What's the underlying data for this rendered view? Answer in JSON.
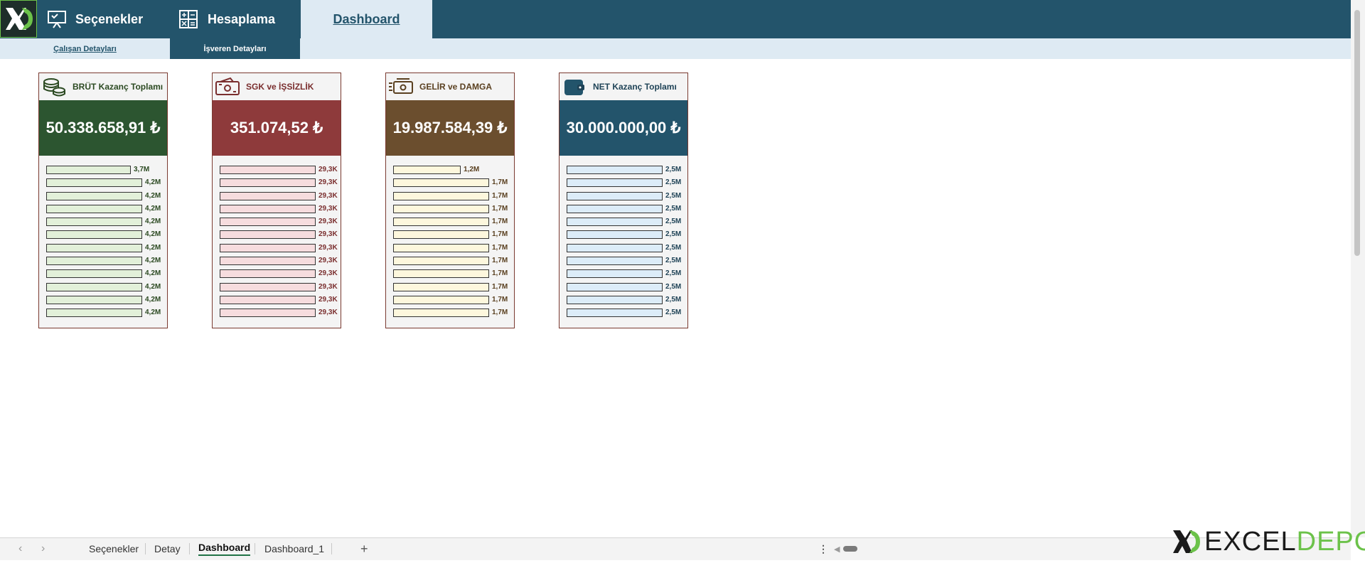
{
  "nav": {
    "options": "Seçenekler",
    "calc": "Hesaplama",
    "dashboard": "Dashboard"
  },
  "subnav": {
    "employee": "Çalışan Detayları",
    "employer": "İşveren Detayları"
  },
  "cards": [
    {
      "title": "BRÜT Kazanç Toplamı",
      "value": "50.338.658,91 ₺",
      "accent": "#2c5530",
      "bar_fill": "#e2f0d9",
      "label_color": "#2c4a22",
      "bars": [
        {
          "label": "3,7M",
          "value": 3.7
        },
        {
          "label": "4,2M",
          "value": 4.2
        },
        {
          "label": "4,2M",
          "value": 4.2
        },
        {
          "label": "4,2M",
          "value": 4.2
        },
        {
          "label": "4,2M",
          "value": 4.2
        },
        {
          "label": "4,2M",
          "value": 4.2
        },
        {
          "label": "4,2M",
          "value": 4.2
        },
        {
          "label": "4,2M",
          "value": 4.2
        },
        {
          "label": "4,2M",
          "value": 4.2
        },
        {
          "label": "4,2M",
          "value": 4.2
        },
        {
          "label": "4,2M",
          "value": 4.2
        },
        {
          "label": "4,2M",
          "value": 4.2
        }
      ]
    },
    {
      "title": "SGK ve İŞSİZLİK",
      "value": "351.074,52 ₺",
      "accent": "#8e3a3b",
      "bar_fill": "#f6dcde",
      "label_color": "#7a2e2e",
      "bars": [
        {
          "label": "29,3K",
          "value": 29.3
        },
        {
          "label": "29,3K",
          "value": 29.3
        },
        {
          "label": "29,3K",
          "value": 29.3
        },
        {
          "label": "29,3K",
          "value": 29.3
        },
        {
          "label": "29,3K",
          "value": 29.3
        },
        {
          "label": "29,3K",
          "value": 29.3
        },
        {
          "label": "29,3K",
          "value": 29.3
        },
        {
          "label": "29,3K",
          "value": 29.3
        },
        {
          "label": "29,3K",
          "value": 29.3
        },
        {
          "label": "29,3K",
          "value": 29.3
        },
        {
          "label": "29,3K",
          "value": 29.3
        },
        {
          "label": "29,3K",
          "value": 29.3
        }
      ]
    },
    {
      "title": "GELİR ve DAMGA",
      "value": "19.987.584,39 ₺",
      "accent": "#6b4e2e",
      "bar_fill": "#fdf7dd",
      "label_color": "#5a4020",
      "bars": [
        {
          "label": "1,2M",
          "value": 1.2
        },
        {
          "label": "1,7M",
          "value": 1.7
        },
        {
          "label": "1,7M",
          "value": 1.7
        },
        {
          "label": "1,7M",
          "value": 1.7
        },
        {
          "label": "1,7M",
          "value": 1.7
        },
        {
          "label": "1,7M",
          "value": 1.7
        },
        {
          "label": "1,7M",
          "value": 1.7
        },
        {
          "label": "1,7M",
          "value": 1.7
        },
        {
          "label": "1,7M",
          "value": 1.7
        },
        {
          "label": "1,7M",
          "value": 1.7
        },
        {
          "label": "1,7M",
          "value": 1.7
        },
        {
          "label": "1,7M",
          "value": 1.7
        }
      ]
    },
    {
      "title": "NET Kazanç Toplamı",
      "value": "30.000.000,00 ₺",
      "accent": "#23546b",
      "bar_fill": "#dcecf8",
      "label_color": "#1f4357",
      "bars": [
        {
          "label": "2,5M",
          "value": 2.5
        },
        {
          "label": "2,5M",
          "value": 2.5
        },
        {
          "label": "2,5M",
          "value": 2.5
        },
        {
          "label": "2,5M",
          "value": 2.5
        },
        {
          "label": "2,5M",
          "value": 2.5
        },
        {
          "label": "2,5M",
          "value": 2.5
        },
        {
          "label": "2,5M",
          "value": 2.5
        },
        {
          "label": "2,5M",
          "value": 2.5
        },
        {
          "label": "2,5M",
          "value": 2.5
        },
        {
          "label": "2,5M",
          "value": 2.5
        },
        {
          "label": "2,5M",
          "value": 2.5
        },
        {
          "label": "2,5M",
          "value": 2.5
        }
      ]
    }
  ],
  "sheets": {
    "tab1": "Seçenekler",
    "tab2": "Detay",
    "tab3": "Dashboard",
    "tab4": "Dashboard_1",
    "add": "+"
  },
  "watermark": {
    "part1": "EXCEL",
    "part2": "DEPO"
  },
  "icons": {
    "logo": "xd-logo-icon",
    "options": "presentation-board-icon",
    "calc": "calculator-icon",
    "card_icons": [
      "coins-icon",
      "banknote-icon",
      "cash-hand-icon",
      "wallet-icon"
    ]
  }
}
